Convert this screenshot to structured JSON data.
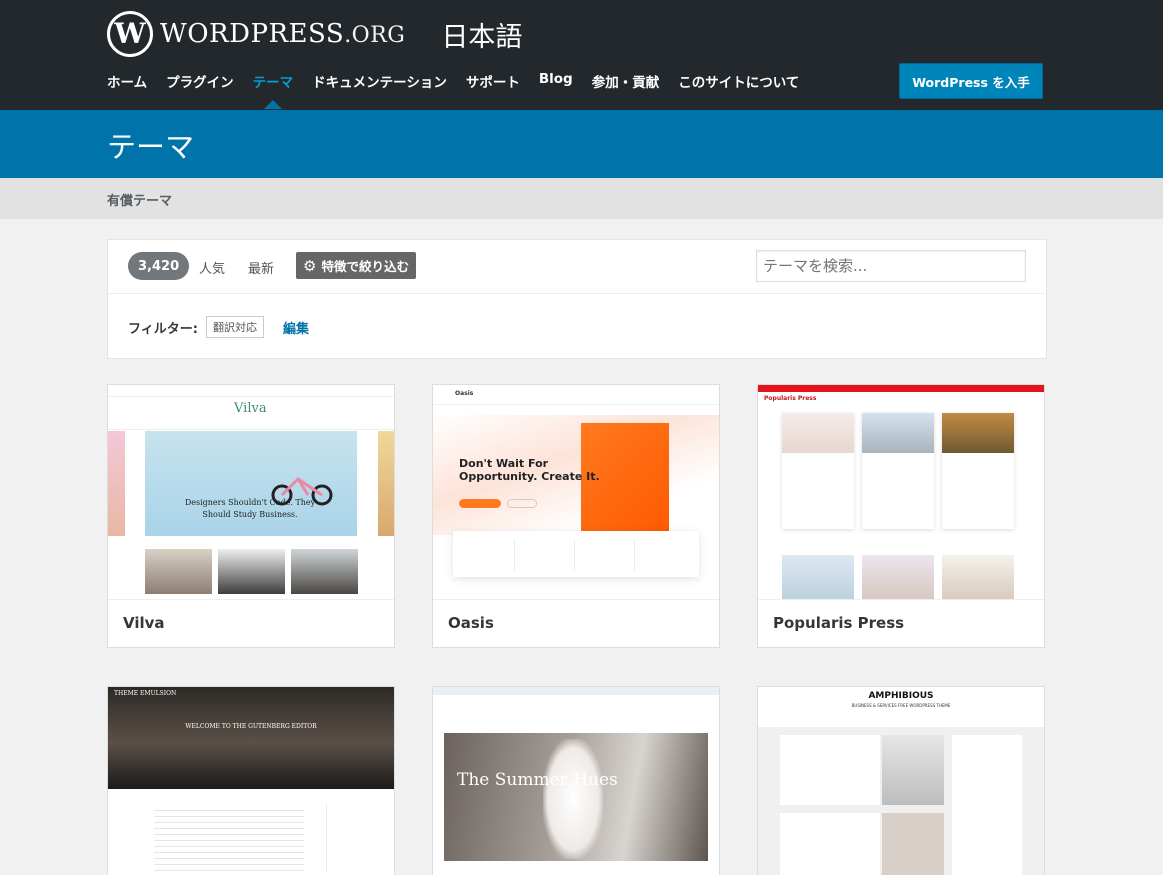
{
  "header": {
    "logo_text": "WORDPRESS",
    "logo_suffix": ".ORG",
    "locale": "日本語",
    "nav": [
      "ホーム",
      "プラグイン",
      "テーマ",
      "ドキュメンテーション",
      "サポート",
      "Blog",
      "参加・貢献",
      "このサイトについて"
    ],
    "active_nav": "テーマ",
    "get_wp_label": "WordPress を入手"
  },
  "page": {
    "title": "テーマ",
    "sub_link": "有償テーマ"
  },
  "filters": {
    "count": "3,420",
    "popular": "人気",
    "latest": "最新",
    "feature_filter": "特徴で絞り込む",
    "search_placeholder": "テーマを検索...",
    "filter_label": "フィルター:",
    "tag": "翻訳対応",
    "edit": "編集"
  },
  "themes": [
    {
      "name": "Vilva",
      "hero_text": "Designers Shouldn't Code. They Should Study Business."
    },
    {
      "name": "Oasis",
      "hero_text": "Don't Wait For Opportunity. Create It."
    },
    {
      "name": "Popularis Press",
      "hero_text": "Popularis Press"
    },
    {
      "name": "",
      "hero_text": "WELCOME TO THE GUTENBERG EDITOR",
      "brand": "THEME EMULSION"
    },
    {
      "name": "",
      "hero_text": "The Summer Hues"
    },
    {
      "name": "",
      "hero_text": "AMPHIBIOUS",
      "sub_text": "BUSINESS & SERVICES FREE WORDPRESS THEME"
    }
  ],
  "icons": {
    "gear": "gear-icon",
    "logo": "wordpress-logo-icon"
  },
  "colors": {
    "header_bg": "#23282d",
    "accent": "#0073aa",
    "active_nav": "#00a0d2",
    "button": "#0085ba"
  }
}
